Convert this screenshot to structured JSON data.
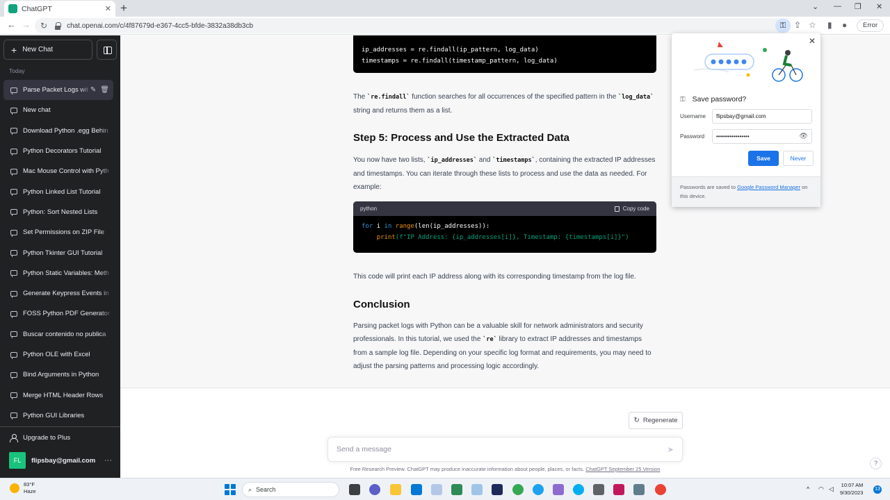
{
  "browser": {
    "tab_title": "ChatGPT",
    "url": "chat.openai.com/c/4f87679d-e367-4cc5-bfde-3832a38db3cb",
    "error_label": "Error"
  },
  "sidebar": {
    "new_chat": "New Chat",
    "section_label": "Today",
    "items": [
      "Parse Packet Logs wit",
      "New chat",
      "Download Python .egg Behin",
      "Python Decorators Tutorial",
      "Mac Mouse Control with Pyth",
      "Python Linked List Tutorial",
      "Python: Sort Nested Lists",
      "Set Permissions on ZIP File",
      "Python Tkinter GUI Tutorial",
      "Python Static Variables: Meth",
      "Generate Keypress Events in",
      "FOSS Python PDF Generator",
      "Buscar contenido no publica",
      "Python OLE with Excel",
      "Bind Arguments in Python",
      "Merge HTML Header Rows",
      "Python GUI Libraries"
    ],
    "upgrade": "Upgrade to Plus",
    "user_initials": "FL",
    "user_email": "flipsbay@gmail.com"
  },
  "content": {
    "code1_line1": "ip_addresses = re.findall(ip_pattern, log_data)",
    "code1_line2": "timestamps = re.findall(timestamp_pattern, log_data)",
    "p1_a": "The ",
    "p1_code1": "`re.findall`",
    "p1_b": " function searches for all occurrences of the specified pattern in the ",
    "p1_code2": "`log_data`",
    "p1_c": " string and returns them as a list.",
    "h_step5": "Step 5: Process and Use the Extracted Data",
    "p2_a": "You now have two lists, ",
    "p2_code1": "`ip_addresses`",
    "p2_b": " and ",
    "p2_code2": "`timestamps`",
    "p2_c": ", containing the extracted IP addresses and timestamps. You can iterate through these lists to process and use the data as needed. For example:",
    "code2_lang": "python",
    "copy_code": "Copy code",
    "code2_for": "for",
    "code2_i": " i ",
    "code2_in": "in",
    "code2_range": " range",
    "code2_rest1": "(len(ip_addresses)):",
    "code2_indent": "    ",
    "code2_print": "print",
    "code2_fstr": "(f\"IP Address: {ip_addresses[i]}, Timestamp: {timestamps[i]}\")",
    "p3": "This code will print each IP address along with its corresponding timestamp from the log file.",
    "h_conclusion": "Conclusion",
    "p4_a": "Parsing packet logs with Python can be a valuable skill for network administrators and security professionals. In this tutorial, we used the ",
    "p4_code": "`re`",
    "p4_b": " library to extract IP addresses and timestamps from a sample log file. Depending on your specific log format and requirements, you may need to adjust the parsing patterns and processing logic accordingly."
  },
  "composer": {
    "regenerate": "Regenerate",
    "placeholder": "Send a message",
    "footer_text": "Free Research Preview. ChatGPT may produce inaccurate information about people, places, or facts. ",
    "footer_link": "ChatGPT September 25 Version"
  },
  "password_popup": {
    "title": "Save password?",
    "username_label": "Username",
    "username_value": "flipsbay@gmail.com",
    "password_label": "Password",
    "password_value": "•••••••••••••••••",
    "save": "Save",
    "never": "Never",
    "foot_a": "Passwords are saved to ",
    "foot_link": "Google Password Manager",
    "foot_b": " on this device."
  },
  "taskbar": {
    "temperature": "83°F",
    "condition": "Haze",
    "search": "Search",
    "time": "10:07 AM",
    "date": "9/30/2023",
    "notifications": "13"
  },
  "colors": {
    "sidebar_bg": "#202123",
    "accent_green": "#10a37f",
    "chrome_blue": "#1a73e8"
  }
}
